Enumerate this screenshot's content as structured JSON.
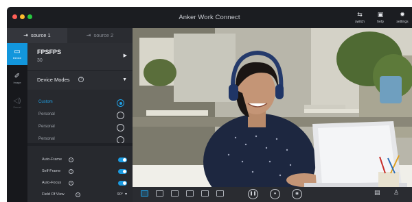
{
  "app": {
    "title": "Anker Work Connect",
    "toolbar": [
      {
        "label": "switch",
        "icon": "switch-icon",
        "glyph": "⇆"
      },
      {
        "label": "help",
        "icon": "help-icon",
        "glyph": "▣"
      },
      {
        "label": "settings",
        "icon": "gear-icon",
        "glyph": "✹"
      }
    ]
  },
  "sources": {
    "tabs": [
      {
        "label": "source 1",
        "active": true
      },
      {
        "label": "source 2",
        "active": false
      }
    ]
  },
  "rail": {
    "items": [
      {
        "label": "Device",
        "icon": "monitor-icon",
        "active": true
      },
      {
        "label": "Image",
        "icon": "magic-wand-icon",
        "active": false
      },
      {
        "label": "Sound",
        "icon": "speaker-icon",
        "active": false
      }
    ]
  },
  "panel": {
    "fps": {
      "title": "FPSFPS",
      "value": "30"
    },
    "device_modes": {
      "title": "Device Modes",
      "help": "?",
      "options": [
        "Custom",
        "Personal",
        "Personal",
        "Personal"
      ],
      "selected_index": 0
    },
    "options": [
      {
        "label": "Auto-Frame",
        "enabled": true
      },
      {
        "label": "Self-Frame",
        "enabled": true
      },
      {
        "label": "Auto-Focus",
        "enabled": true
      }
    ],
    "field_of_view": {
      "label": "Field Of View",
      "value": "90°"
    }
  },
  "accent_color": "#1fa0e6"
}
